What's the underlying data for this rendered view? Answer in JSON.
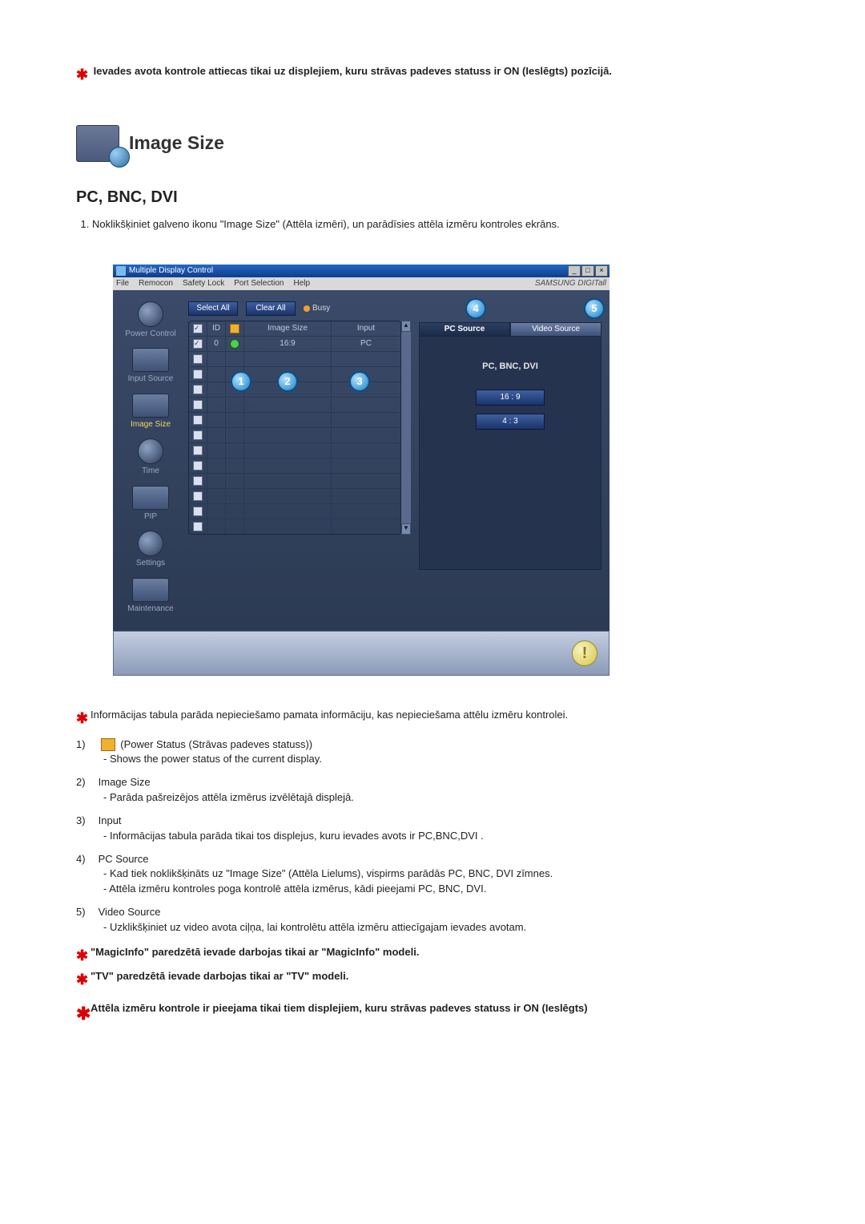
{
  "top_note": "Ievades avota kontrole attiecas tikai uz displejiem, kuru strāvas padeves statuss ir ON (Ieslēgts) pozīcijā.",
  "section_title": "Image Size",
  "sub_heading": "PC, BNC, DVI",
  "step1": "Noklikšķiniet galveno ikonu \"Image Size\" (Attēla izmēri), un parādīsies attēla izmēru kontroles ekrāns.",
  "app": {
    "title": "Multiple Display Control",
    "menu": {
      "file": "File",
      "remocon": "Remocon",
      "safety": "Safety Lock",
      "port": "Port Selection",
      "help": "Help"
    },
    "brand": "SAMSUNG DIGITall",
    "sidebar": {
      "power": "Power Control",
      "input": "Input Source",
      "image": "Image Size",
      "time": "Time",
      "pip": "PIP",
      "settings": "Settings",
      "maint": "Maintenance"
    },
    "buttons": {
      "select_all": "Select All",
      "clear_all": "Clear All"
    },
    "busy": "Busy",
    "grid": {
      "head_id": "ID",
      "head_size": "Image Size",
      "head_input": "Input",
      "row0_id": "0",
      "row0_size": "16:9",
      "row0_input": "PC"
    },
    "badges": {
      "b1": "1",
      "b2": "2",
      "b3": "3",
      "b4": "4",
      "b5": "5"
    },
    "tabs": {
      "pc": "PC Source",
      "video": "Video Source"
    },
    "panel_title": "PC, BNC, DVI",
    "opt1": "16 : 9",
    "opt2": "4 : 3"
  },
  "desc": {
    "star1": "Informācijas tabula parāda nepieciešamo pamata informāciju, kas nepieciešama attēlu izmēru kontrolei.",
    "n1_lbl": "1)",
    "n1_txt": "(Power Status (Strāvas padeves statuss))",
    "n1_sub": "Shows the power status of the current display.",
    "n2_lbl": "2)",
    "n2_title": "Image Size",
    "n2_sub": "Parāda pašreizējos attēla izmērus izvēlētajā displejā.",
    "n3_lbl": "3)",
    "n3_title": "Input",
    "n3_sub": "Informācijas tabula parāda tikai tos displejus, kuru ievades avots ir PC,BNC,DVI .",
    "n4_lbl": "4)",
    "n4_title": "PC Source",
    "n4_sub1": "Kad tiek noklikšķināts uz \"Image Size\" (Attēla Lielums), vispirms parādās PC, BNC, DVI zīmnes.",
    "n4_sub2": "Attēla izmēru kontroles poga kontrolē attēla izmērus, kādi pieejami PC, BNC, DVI.",
    "n5_lbl": "5)",
    "n5_title": "Video Source",
    "n5_sub": "Uzklikšķiniet uz video avota ciļņa, lai kontrolētu attēla izmēru attiecīgajam ievades avotam.",
    "star2": "\"MagicInfo\" paredzētā ievade darbojas tikai ar \"MagicInfo\" modeli.",
    "star3": "\"TV\" paredzētā ievade darbojas tikai ar \"TV\" modeli.",
    "star4": "Attēla izmēru kontrole ir pieejama tikai tiem displejiem, kuru strāvas padeves statuss ir ON (Ieslēgts)"
  }
}
